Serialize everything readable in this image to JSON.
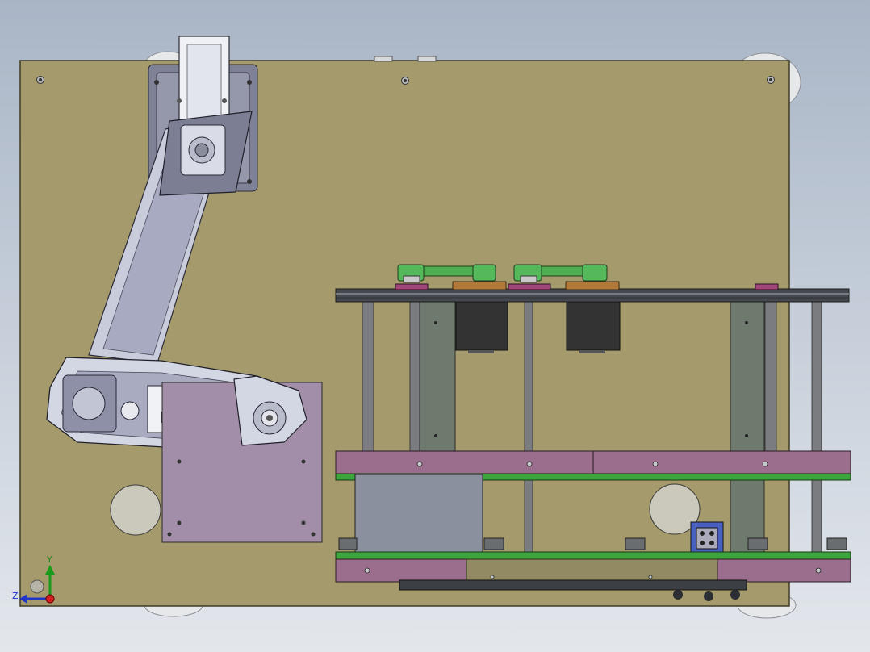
{
  "view": {
    "background_top": "#a9b5c6",
    "background_bottom": "#e3e7ec"
  },
  "colors": {
    "base_plate": "#a59a6b",
    "robot_arm": "#cfd2e0",
    "robot_arm_dark": "#6a6c7c",
    "frame_rail": "#45494f",
    "pink_plate": "#9a6e8c",
    "green_plate": "#3da53d",
    "green_pulley_belt": "#4fae52",
    "stepper_motor": "#333333",
    "orange_block": "#b27a3a",
    "grey_panel": "#8a909e",
    "mount_plate": "#a28ea8",
    "round_disc": "#cbc9bb",
    "foot_pad": "#e6e8ea"
  },
  "icons": [
    "triad-axis-icon",
    "y-axis-arrow-icon",
    "z-axis-arrow-icon",
    "origin-dot-icon",
    "view-rotate-icon"
  ],
  "axes": {
    "y_label": "Y",
    "z_label": "Z"
  }
}
